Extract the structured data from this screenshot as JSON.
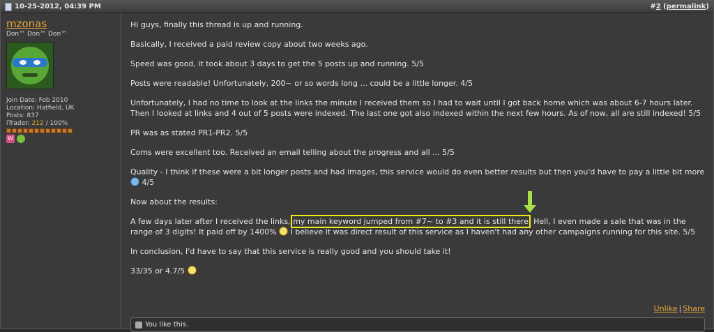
{
  "header": {
    "date": "10-25-2012, 04:39 PM",
    "post_number_prefix": "#",
    "post_number": "2",
    "permalink_open": "(",
    "permalink": "permalink",
    "permalink_close": ")"
  },
  "user": {
    "name": "mzonas",
    "title": "Don™ Don™ Don™",
    "join_date": "Join Date: Feb 2010",
    "location": "Location: Hatfield, UK",
    "posts": "Posts: 837",
    "itrader_label": "iTrader: ",
    "itrader_count": "212",
    "itrader_pct": " / 100%"
  },
  "post": {
    "p1": "Hi guys, finally this thread is up and running.",
    "p2": "Basically, I received a paid review copy about two weeks ago.",
    "p3": "Speed was good, it took about 3 days to get the 5 posts up and running. 5/5",
    "p4": "Posts were readable! Unfortunately, 200~ or so words long ... could be a little longer. 4/5",
    "p5": "Unfortunately, I had no time to look at the links the minute I received them so I had to wait until I got back home which was about 6-7 hours later. Then I looked at links and 4 out of 5 posts were indexed. The last one got also indexed within the next few hours. As of now, all are still indexed! 5/5",
    "p6": "PR was as stated PR1-PR2. 5/5",
    "p7": "Coms were excellent too. Received an email telling about the progress and all ... 5/5",
    "p8_a": "Quality - I think if these were a bit longer posts and had images, this service would do even better results but then you'd have to pay a little bit more",
    "p8_b": " 4/5",
    "p9": "Now about the results:",
    "p10_a": "A few days later after I received the links, ",
    "p10_hl": "my main keyword jumped from #7~ to #3 and it is still there",
    "p10_b": ". Hell, I even made a sale that was in the range of 3 digits! It paid off by 1400%",
    "p10_c": " I believe it was direct result of this service as I haven't had any other campaigns running for this site. 5/5",
    "p11": "In conclusion, I'd have to say that this service is really good and you should take it!",
    "p12": "33/35 or 4.7/5"
  },
  "actions": {
    "unlike": "Unlike",
    "separator": "|",
    "share": "Share"
  },
  "like_bar": {
    "text": "You like this."
  },
  "icons": [
    "document-icon",
    "smiley-icon",
    "blue-smiley-icon",
    "arrow-down-icon",
    "like-icon"
  ]
}
